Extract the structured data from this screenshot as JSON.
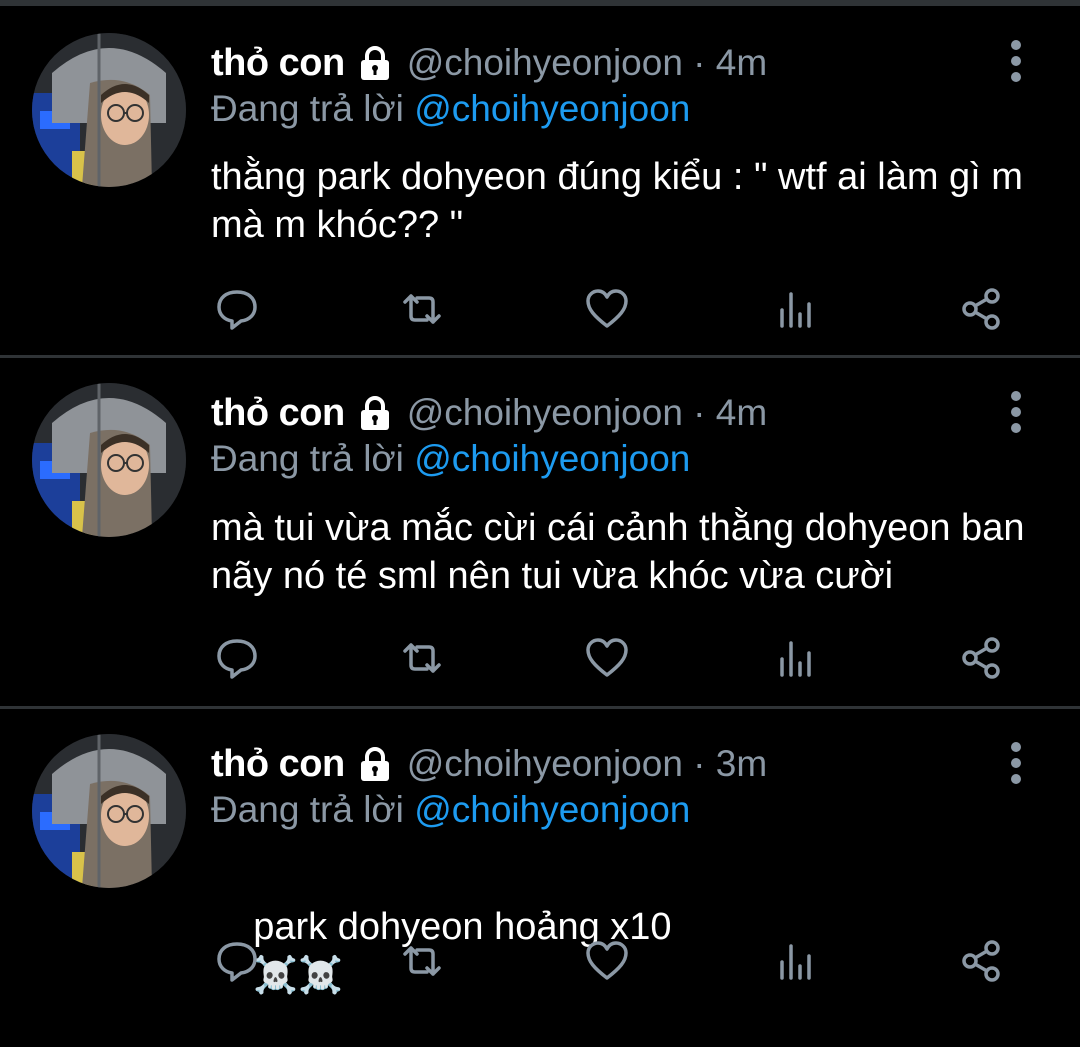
{
  "colors": {
    "background": "#000000",
    "divider": "#2f3336",
    "muted": "#8b98a5",
    "link": "#1d9bf0"
  },
  "tweets": [
    {
      "name": "thỏ con",
      "handle_time": "@choihyeonjoon · 4m",
      "reply_prefix": "Đang trả lời",
      "reply_handle": "@choihyeonjoon",
      "text": "thằng park dohyeon đúng kiểu : \" wtf ai làm gì m mà m khóc?? \""
    },
    {
      "name": "thỏ con",
      "handle_time": "@choihyeonjoon · 4m",
      "reply_prefix": "Đang trả lời",
      "reply_handle": "@choihyeonjoon",
      "text": "mà tui vừa mắc cừi cái cảnh thằng dohyeon ban nãy nó té sml nên tui vừa khóc vừa cười"
    },
    {
      "name": "thỏ con",
      "handle_time": "@choihyeonjoon · 3m",
      "reply_prefix": "Đang trả lời",
      "reply_handle": "@choihyeonjoon",
      "text": "park dohyeon hoảng x10",
      "emoji": "☠️☠️"
    }
  ],
  "icons": [
    "avatar",
    "lock-icon",
    "more-icon",
    "reply-icon",
    "retweet-icon",
    "like-icon",
    "analytics-icon",
    "share-icon"
  ]
}
